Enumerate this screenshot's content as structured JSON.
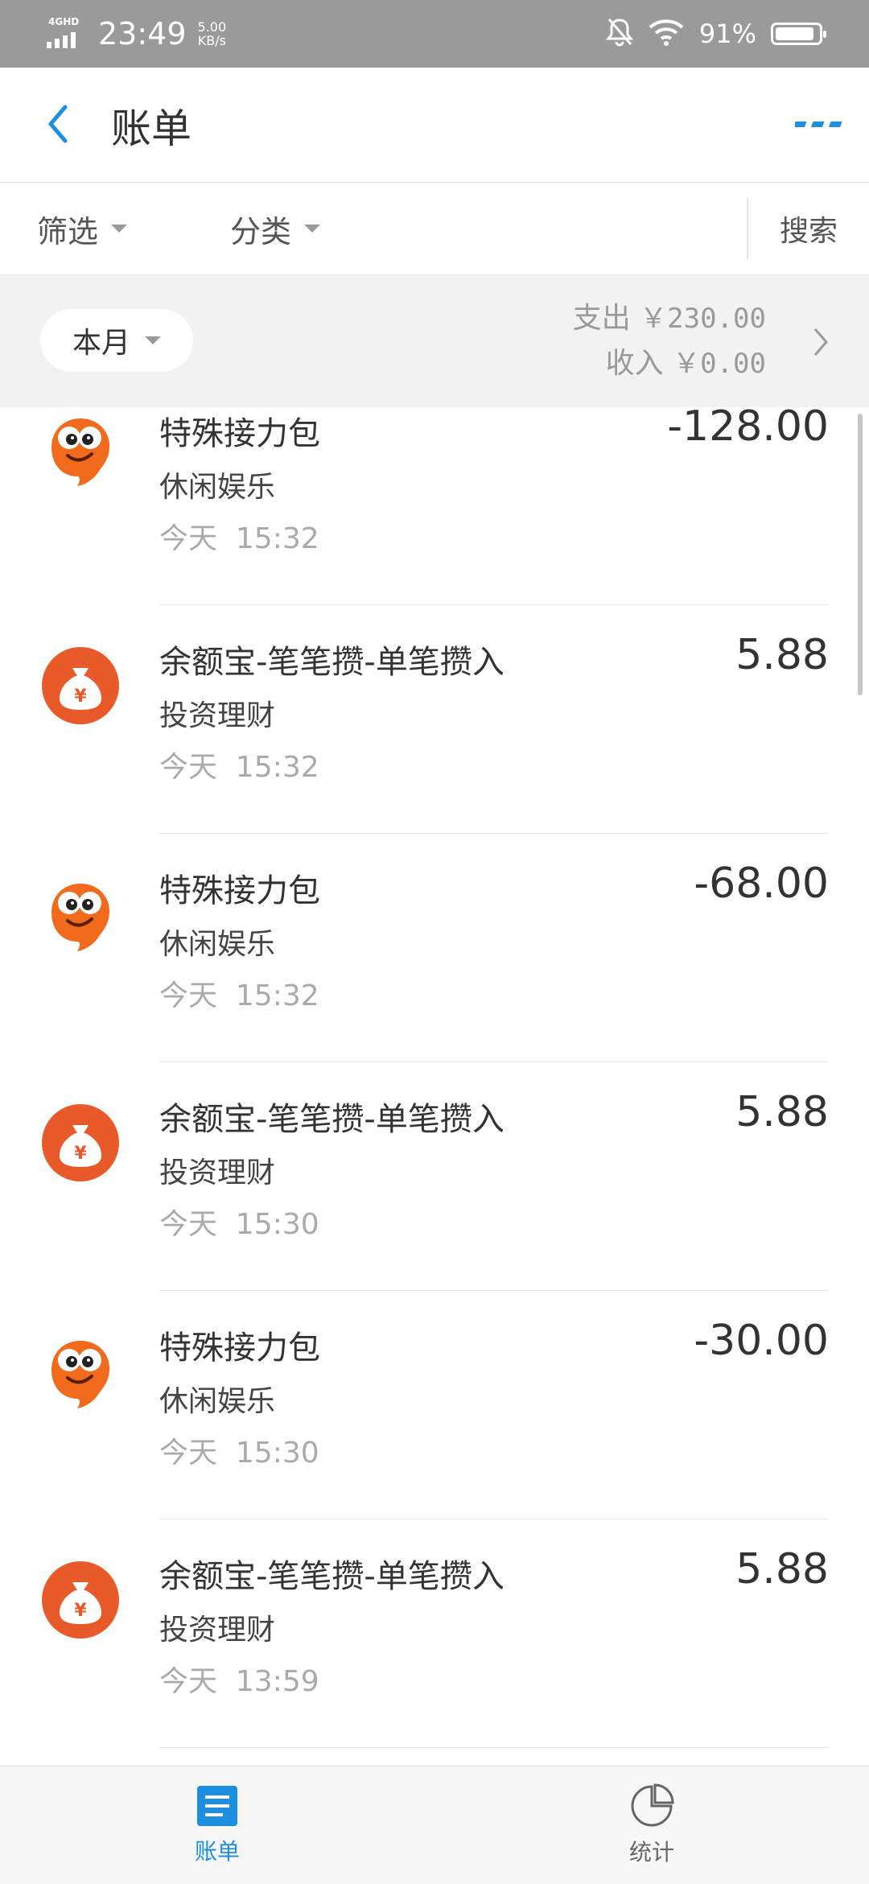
{
  "status_bar": {
    "network": "4GHD",
    "time": "23:49",
    "speed_value": "5.00",
    "speed_unit": "KB/s",
    "battery": "91%",
    "battery_level": 0.91,
    "icons": [
      "signal-icon",
      "mute-bell-icon",
      "wifi-icon",
      "battery-icon"
    ]
  },
  "header": {
    "title": "账单",
    "accent_color": "#1d8fe1"
  },
  "filters": {
    "filter_label": "筛选",
    "category_label": "分类",
    "search_label": "搜索"
  },
  "month_summary": {
    "period_label": "本月",
    "expense_label": "支出",
    "expense_amount": "￥230.00",
    "income_label": "收入",
    "income_amount": "￥0.00"
  },
  "transactions": [
    {
      "title": "特殊接力包",
      "category": "休闲娱乐",
      "day": "今天",
      "time": "15:32",
      "amount": "-128.00",
      "icon": "mascot-icon"
    },
    {
      "title": "余额宝-笔笔攒-单笔攒入",
      "category": "投资理财",
      "day": "今天",
      "time": "15:32",
      "amount": "5.88",
      "icon": "money-bag-icon"
    },
    {
      "title": "特殊接力包",
      "category": "休闲娱乐",
      "day": "今天",
      "time": "15:32",
      "amount": "-68.00",
      "icon": "mascot-icon"
    },
    {
      "title": "余额宝-笔笔攒-单笔攒入",
      "category": "投资理财",
      "day": "今天",
      "time": "15:30",
      "amount": "5.88",
      "icon": "money-bag-icon"
    },
    {
      "title": "特殊接力包",
      "category": "休闲娱乐",
      "day": "今天",
      "time": "15:30",
      "amount": "-30.00",
      "icon": "mascot-icon"
    },
    {
      "title": "余额宝-笔笔攒-单笔攒入",
      "category": "投资理财",
      "day": "今天",
      "time": "13:59",
      "amount": "5.88",
      "icon": "money-bag-icon"
    }
  ],
  "bottom_nav": {
    "bill_label": "账单",
    "stats_label": "统计",
    "active_tab": "账单"
  }
}
